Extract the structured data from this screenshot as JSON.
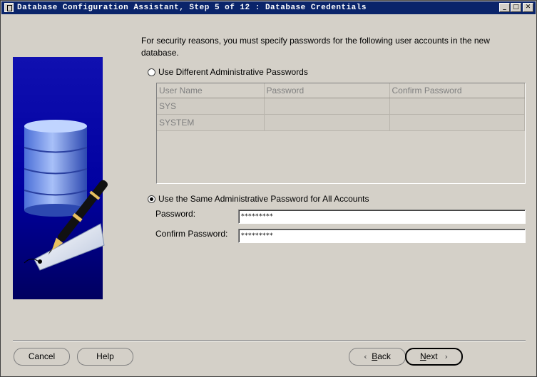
{
  "window": {
    "title": "Database Configuration Assistant, Step 5 of 12 : Database Credentials",
    "controls": {
      "minimize": "_",
      "maximize": "□",
      "close": "✕"
    }
  },
  "main": {
    "intro_text": "For security reasons, you must specify passwords for the following user accounts in the new database.",
    "option_different": {
      "label": "Use Different Administrative Passwords",
      "selected": false
    },
    "table": {
      "columns": [
        "User Name",
        "Password",
        "Confirm Password"
      ],
      "rows": [
        {
          "user": "SYS",
          "password": "",
          "confirm": ""
        },
        {
          "user": "SYSTEM",
          "password": "",
          "confirm": ""
        }
      ]
    },
    "option_same": {
      "label": "Use the Same Administrative Password for All Accounts",
      "selected": true
    },
    "password_label": "Password:",
    "password_value": "*********",
    "confirm_label": "Confirm Password:",
    "confirm_value": "*********"
  },
  "buttons": {
    "cancel": "Cancel",
    "help": "Help",
    "back_mnemonic": "B",
    "back_rest": "ack",
    "next_mnemonic": "N",
    "next_rest": "ext"
  },
  "icons": [
    "database-icon",
    "pen-icon",
    "tag-icon",
    "back-arrow-icon",
    "next-arrow-icon"
  ],
  "colors": {
    "titlebar": "#0a246a",
    "banner": "#0000a0",
    "background": "#d4d0c8"
  }
}
